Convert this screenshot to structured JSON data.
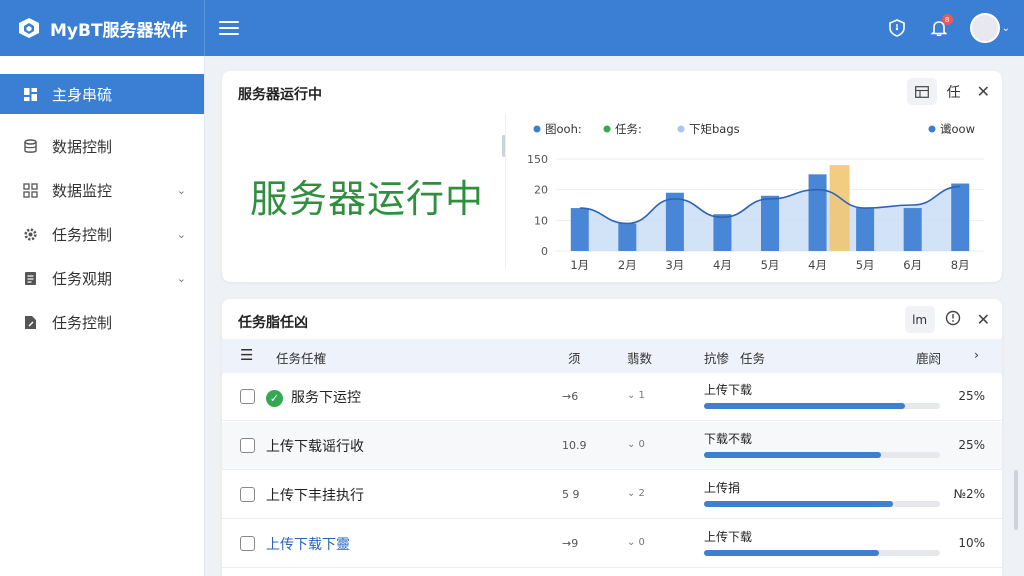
{
  "app": {
    "title": "MyBT服务器软件"
  },
  "topbar": {
    "notif_count": "8"
  },
  "sidebar": {
    "items": [
      {
        "label": "主身串硫",
        "icon": "dashboard-icon",
        "active": true,
        "chevron": false
      },
      {
        "label": "数据控制",
        "icon": "database-icon",
        "active": false,
        "chevron": false
      },
      {
        "label": "数据监控",
        "icon": "grid-icon",
        "active": false,
        "chevron": true
      },
      {
        "label": "任务控制",
        "icon": "gear-icon",
        "active": false,
        "chevron": true
      },
      {
        "label": "任务观期",
        "icon": "document-icon",
        "active": false,
        "chevron": true
      },
      {
        "label": "任务控制",
        "icon": "file-edit-icon",
        "active": false,
        "chevron": false
      }
    ]
  },
  "status_card": {
    "title": "服务器运行中",
    "big_text": "服务器运行中",
    "tool_label": "任"
  },
  "chart_data": {
    "type": "bar",
    "categories": [
      "1月",
      "2月",
      "3月",
      "4月",
      "5月",
      "4月",
      "5月",
      "6月",
      "8月"
    ],
    "legend": [
      "图ooh:",
      "任务:",
      "下矩bags",
      "谶oow"
    ],
    "series_colors": [
      "#3b7fd4",
      "#35a853",
      "#a9c8f0",
      "#3b7fd4"
    ],
    "values": [
      14,
      9,
      19,
      12,
      18,
      25,
      14,
      14,
      22
    ],
    "highlight_index": 5,
    "highlight_value": 28,
    "highlight_color": "#f2c36b",
    "line": [
      14,
      9,
      17,
      11,
      17,
      20,
      14,
      15,
      21
    ],
    "yticks": [
      "0",
      "10",
      "20",
      "150"
    ],
    "ylim": [
      0,
      30
    ]
  },
  "task_card": {
    "title": "任务脂任凶",
    "tool_label": "lm",
    "columns": {
      "name": "任务任榷",
      "c1": "须",
      "c2": "翡数",
      "c3": "抗惨",
      "task": "任务",
      "pct": "鹿阏"
    },
    "rows": [
      {
        "name": "服务下运控",
        "ok": true,
        "v1": "→6",
        "v2": "⌄ 1",
        "task": "上传下载",
        "progress": 0.85,
        "pct": "25%",
        "alt": false
      },
      {
        "name": "上传下载谣行收",
        "ok": false,
        "v1": "10.9",
        "v2": "⌄ 0",
        "task": "下载不载",
        "progress": 0.75,
        "pct": "25%",
        "alt": true
      },
      {
        "name": "上传下丰挂执行",
        "ok": false,
        "v1": "5 9",
        "v2": "⌄ 2",
        "task": "上传捐",
        "progress": 0.8,
        "pct": "№2%",
        "alt": false
      },
      {
        "name": "上传下载下靈",
        "ok": false,
        "v1": "→9",
        "v2": "⌄ 0",
        "task": "上传下载",
        "progress": 0.74,
        "pct": "10%",
        "alt": false
      }
    ]
  }
}
